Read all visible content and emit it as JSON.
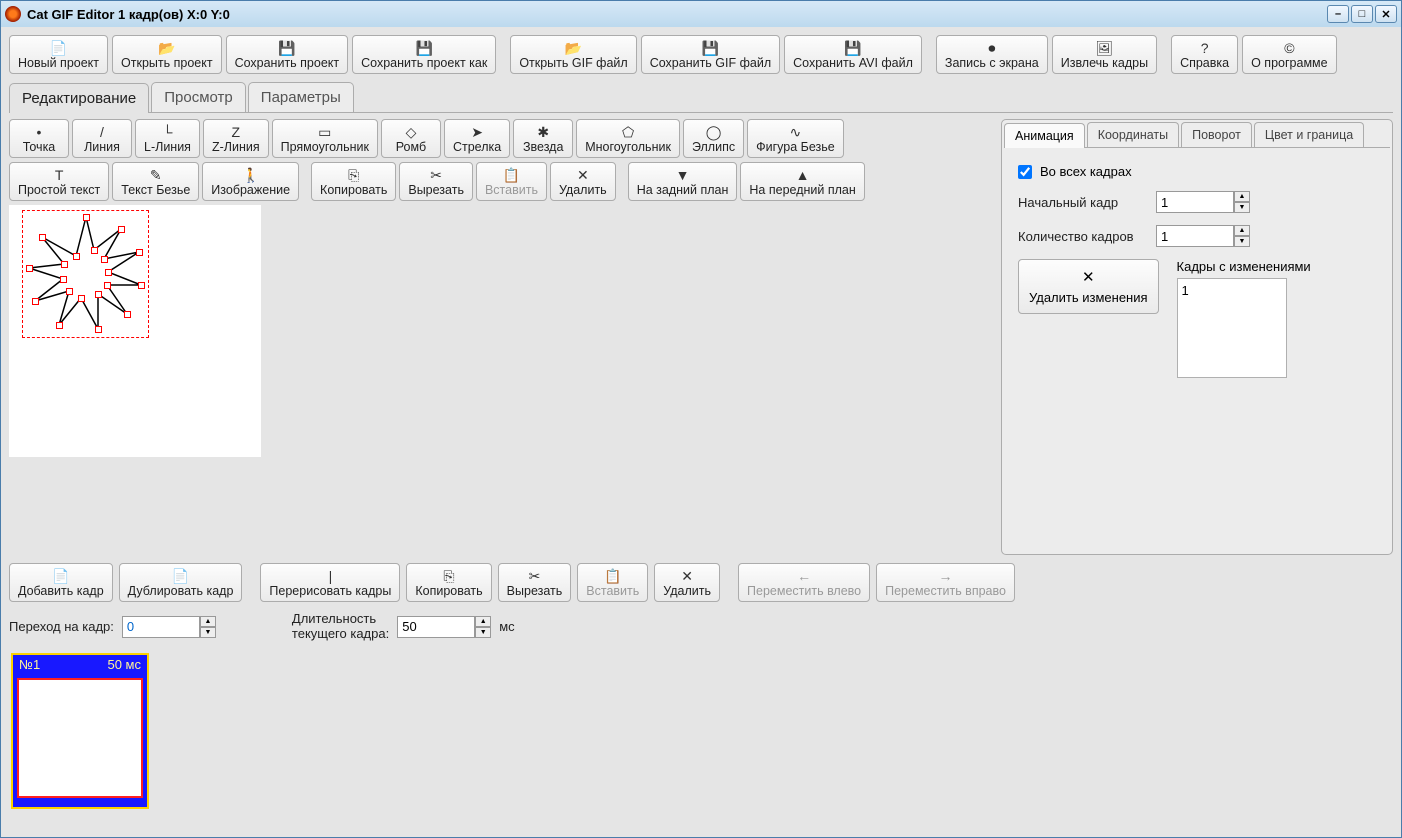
{
  "title": "Cat GIF Editor 1 кадр(ов) X:0 Y:0",
  "main_toolbar": [
    {
      "id": "new-project",
      "label": "Новый проект",
      "icon": "📄"
    },
    {
      "id": "open-project",
      "label": "Открыть проект",
      "icon": "📂"
    },
    {
      "id": "save-project",
      "label": "Сохранить проект",
      "icon": "💾"
    },
    {
      "id": "save-project-as",
      "label": "Сохранить проект как",
      "icon": "💾"
    },
    {
      "id": "open-gif",
      "label": "Открыть GIF файл",
      "icon": "📂"
    },
    {
      "id": "save-gif",
      "label": "Сохранить GIF файл",
      "icon": "💾"
    },
    {
      "id": "save-avi",
      "label": "Сохранить AVI файл",
      "icon": "💾"
    },
    {
      "id": "screen-record",
      "label": "Запись с экрана",
      "icon": "⏺"
    },
    {
      "id": "extract-frames",
      "label": "Извлечь кадры",
      "icon": "🖼"
    },
    {
      "id": "help",
      "label": "Справка",
      "icon": "?"
    },
    {
      "id": "about",
      "label": "О программе",
      "icon": "©"
    }
  ],
  "main_tabs": [
    "Редактирование",
    "Просмотр",
    "Параметры"
  ],
  "shape_tools_row1": [
    {
      "id": "point",
      "label": "Точка",
      "icon": "•"
    },
    {
      "id": "line",
      "label": "Линия",
      "icon": "/"
    },
    {
      "id": "l-line",
      "label": "L-Линия",
      "icon": "└"
    },
    {
      "id": "z-line",
      "label": "Z-Линия",
      "icon": "Z"
    },
    {
      "id": "rect",
      "label": "Прямоугольник",
      "icon": "▭"
    },
    {
      "id": "rhomb",
      "label": "Ромб",
      "icon": "◇"
    },
    {
      "id": "arrow",
      "label": "Стрелка",
      "icon": "➤"
    },
    {
      "id": "star",
      "label": "Звезда",
      "icon": "✱"
    },
    {
      "id": "polygon",
      "label": "Многоугольник",
      "icon": "⬠"
    },
    {
      "id": "ellipse",
      "label": "Эллипс",
      "icon": "◯"
    },
    {
      "id": "bezier",
      "label": "Фигура Безье",
      "icon": "∿"
    }
  ],
  "shape_tools_row2": [
    {
      "id": "plain-text",
      "label": "Простой текст",
      "icon": "T"
    },
    {
      "id": "bezier-text",
      "label": "Текст Безье",
      "icon": "✎"
    },
    {
      "id": "image",
      "label": "Изображение",
      "icon": "🚶"
    },
    {
      "id": "copy",
      "label": "Копировать",
      "icon": "⎘"
    },
    {
      "id": "cut",
      "label": "Вырезать",
      "icon": "✂"
    },
    {
      "id": "paste",
      "label": "Вставить",
      "icon": "📋",
      "disabled": true
    },
    {
      "id": "delete",
      "label": "Удалить",
      "icon": "✕"
    },
    {
      "id": "send-back",
      "label": "На задний план",
      "icon": "▼"
    },
    {
      "id": "bring-front",
      "label": "На передний план",
      "icon": "▲"
    }
  ],
  "side_tabs": [
    "Анимация",
    "Координаты",
    "Поворот",
    "Цвет и граница"
  ],
  "animation": {
    "all_frames_label": "Во всех кадрах",
    "all_frames_checked": true,
    "start_frame_label": "Начальный кадр",
    "start_frame_value": "1",
    "frame_count_label": "Количество кадров",
    "frame_count_value": "1",
    "delete_changes_label": "Удалить изменения",
    "changes_list_label": "Кадры с изменениями",
    "changes_list": [
      "1"
    ]
  },
  "frame_ops": [
    {
      "id": "add-frame",
      "label": "Добавить кадр",
      "icon": "📄"
    },
    {
      "id": "dup-frame",
      "label": "Дублировать кадр",
      "icon": "📄"
    },
    {
      "id": "redraw-frames",
      "label": "Перерисовать кадры",
      "icon": "|"
    },
    {
      "id": "copy2",
      "label": "Копировать",
      "icon": "⎘"
    },
    {
      "id": "cut2",
      "label": "Вырезать",
      "icon": "✂"
    },
    {
      "id": "paste2",
      "label": "Вставить",
      "icon": "📋",
      "disabled": true
    },
    {
      "id": "delete2",
      "label": "Удалить",
      "icon": "✕"
    },
    {
      "id": "move-left",
      "label": "Переместить влево",
      "icon": "←",
      "disabled": true
    },
    {
      "id": "move-right",
      "label": "Переместить вправо",
      "icon": "→",
      "disabled": true
    }
  ],
  "params": {
    "goto_frame_label": "Переход на кадр:",
    "goto_frame_value": "0",
    "duration_label1": "Длительность",
    "duration_label2": "текущего кадра:",
    "duration_value": "50",
    "duration_unit": "мс"
  },
  "thumb": {
    "num": "№1",
    "ms": "50 мс"
  }
}
